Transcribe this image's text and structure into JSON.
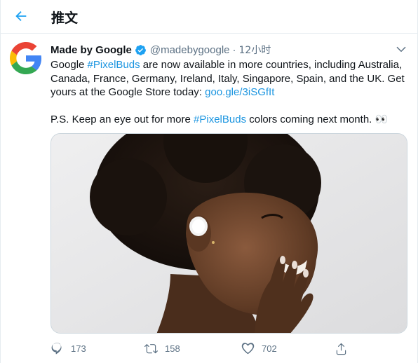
{
  "header": {
    "title": "推文",
    "back_icon": "arrow-left-icon"
  },
  "tweet": {
    "author": {
      "display_name": "Made by Google",
      "handle": "@madebygoogle",
      "verified": true,
      "avatar_icon": "google-g-logo"
    },
    "separator": "·",
    "time": "12小时",
    "text": {
      "p1_a": "Google ",
      "p1_hashtag": "#PixelBuds",
      "p1_b": " are now available in more countries, including Australia, Canada, France, Germany, Ireland, Italy, Singapore, Spain, and the UK. Get yours at the Google Store today: ",
      "p1_link": "goo.gle/3iSGfIt",
      "p2_a": "P.S. Keep an eye out for more ",
      "p2_hashtag": "#PixelBuds",
      "p2_b": " colors coming next month. 👀"
    },
    "media": {
      "type": "photo",
      "icon": "photo-woman-wearing-pixel-buds"
    },
    "actions": {
      "reply_count": "173",
      "retweet_count": "158",
      "like_count": "702"
    }
  },
  "colors": {
    "link": "#1b95e0",
    "accent": "#1da1f2",
    "secondary_text": "#5b7083",
    "border": "#e6ecf0"
  }
}
